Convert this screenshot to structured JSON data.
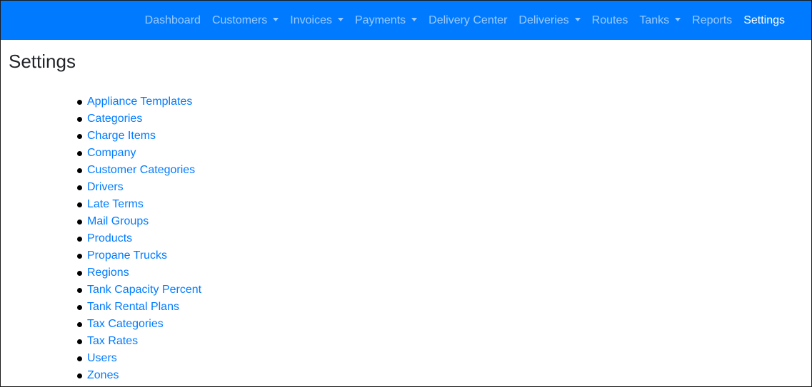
{
  "nav": {
    "items": [
      {
        "label": "Dashboard",
        "dropdown": false
      },
      {
        "label": "Customers",
        "dropdown": true
      },
      {
        "label": "Invoices",
        "dropdown": true
      },
      {
        "label": "Payments",
        "dropdown": true
      },
      {
        "label": "Delivery Center",
        "dropdown": false
      },
      {
        "label": "Deliveries",
        "dropdown": true
      },
      {
        "label": "Routes",
        "dropdown": false
      },
      {
        "label": "Tanks",
        "dropdown": true
      },
      {
        "label": "Reports",
        "dropdown": false
      },
      {
        "label": "Settings",
        "dropdown": false,
        "active": true
      }
    ],
    "colors": {
      "background": "#007bff",
      "link": "rgba(255,255,255,0.6)",
      "active": "#ffffff"
    }
  },
  "page": {
    "title": "Settings"
  },
  "settings": {
    "links": [
      "Appliance Templates",
      "Categories",
      "Charge Items",
      "Company",
      "Customer Categories",
      "Drivers",
      "Late Terms",
      "Mail Groups",
      "Products",
      "Propane Trucks",
      "Regions",
      "Tank Capacity Percent",
      "Tank Rental Plans",
      "Tax Categories",
      "Tax Rates",
      "Users",
      "Zones"
    ],
    "link_color": "#007bff"
  }
}
